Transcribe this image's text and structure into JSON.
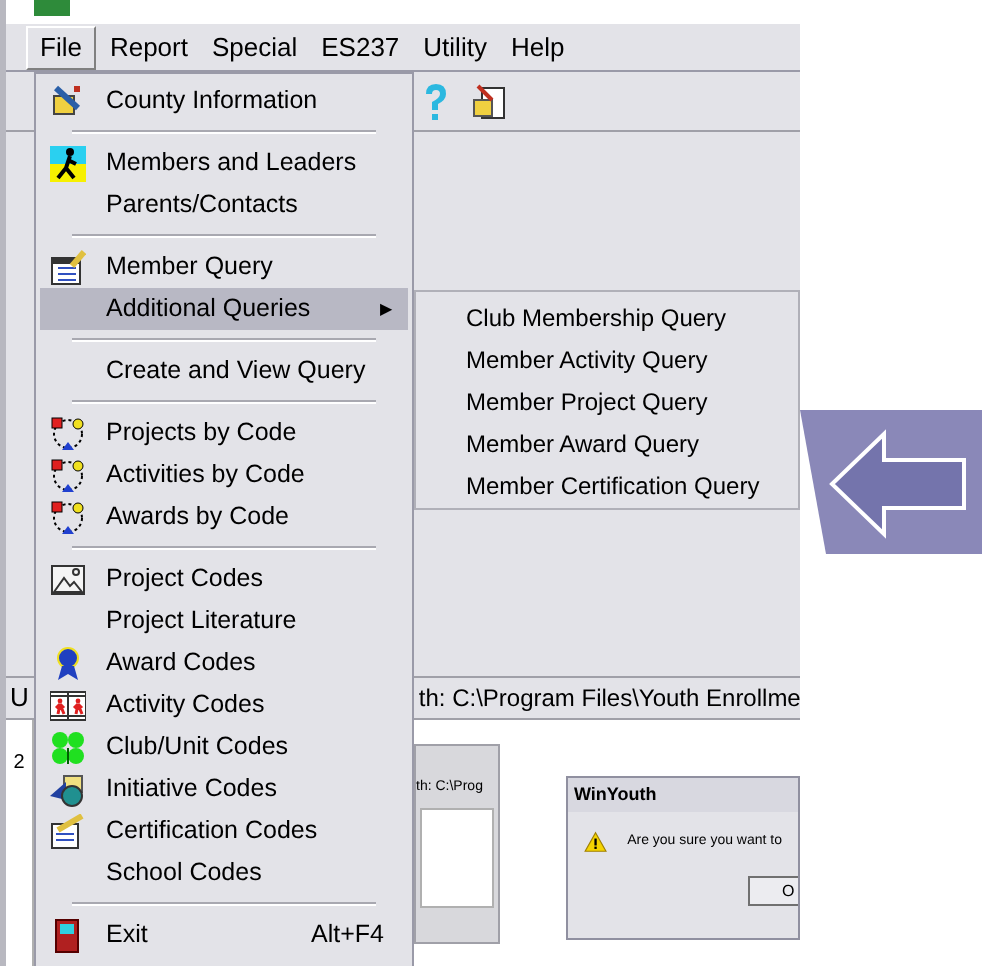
{
  "menu_bar": [
    {
      "label": "File",
      "selected": true
    },
    {
      "label": "Report",
      "selected": false
    },
    {
      "label": "Special",
      "selected": false
    },
    {
      "label": "ES237",
      "selected": false
    },
    {
      "label": "Utility",
      "selected": false
    },
    {
      "label": "Help",
      "selected": false
    }
  ],
  "file_menu": [
    {
      "kind": "item",
      "label": "County Information"
    },
    {
      "kind": "separator"
    },
    {
      "kind": "item",
      "label": "Members and Leaders"
    },
    {
      "kind": "item",
      "label": "Parents/Contacts"
    },
    {
      "kind": "separator"
    },
    {
      "kind": "item",
      "label": "Member Query"
    },
    {
      "kind": "submenu",
      "label": "Additional Queries",
      "arrow": "▶",
      "selected": true,
      "items": [
        "Club Membership Query",
        "Member Activity Query",
        "Member Project Query",
        "Member Award Query",
        "Member Certification Query"
      ]
    },
    {
      "kind": "separator"
    },
    {
      "kind": "item",
      "label": "Create and View Query"
    },
    {
      "kind": "separator"
    },
    {
      "kind": "item",
      "label": "Projects by Code"
    },
    {
      "kind": "item",
      "label": "Activities by Code"
    },
    {
      "kind": "item",
      "label": "Awards by Code"
    },
    {
      "kind": "separator"
    },
    {
      "kind": "item",
      "label": "Project Codes"
    },
    {
      "kind": "item",
      "label": "Project Literature"
    },
    {
      "kind": "item",
      "label": "Award Codes"
    },
    {
      "kind": "item",
      "label": "Activity Codes"
    },
    {
      "kind": "item",
      "label": "Club/Unit Codes"
    },
    {
      "kind": "item",
      "label": "Initiative Codes"
    },
    {
      "kind": "item",
      "label": "Certification Codes"
    },
    {
      "kind": "item",
      "label": "School Codes"
    },
    {
      "kind": "separator"
    },
    {
      "kind": "item",
      "label": "Exit",
      "shortcut": "Alt+F4"
    }
  ],
  "status_bar": {
    "left": "U",
    "path": "th:  C:\\Program Files\\Youth Enrollme"
  },
  "ruler": {
    "label": "2"
  },
  "thumbnail": {
    "path": "th: C:\\Prog"
  },
  "dialog": {
    "title": "WinYouth",
    "message": "Are you sure you want to",
    "button": "O"
  }
}
